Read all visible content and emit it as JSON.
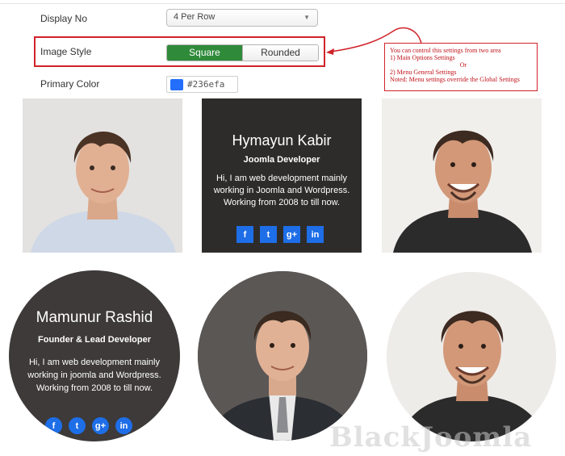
{
  "settings": {
    "display_no": {
      "label": "Display No",
      "value": "4 Per Row"
    },
    "image_style": {
      "label": "Image Style",
      "options": [
        "Square",
        "Rounded"
      ],
      "selected": "Square"
    },
    "primary_color": {
      "label": "Primary Color",
      "value": "#236efa"
    }
  },
  "annotation": {
    "line1": "You can control this settings from two area",
    "line2": "1) Main Options Settings",
    "line3": "Or",
    "line4": "2) Menu General Settings",
    "line5": "Noted: Menu settings override the Global Settings",
    "border_color": "#d0232a"
  },
  "members_square": [
    {
      "photo": "man-young-photo"
    },
    {
      "name": "Hymayun Kabir",
      "role": "Joomla Developer",
      "bio_1": "Hi, I am web development mainly",
      "bio_2": "working in Joomla and Wordpress.",
      "bio_3": "Working from 2008 to till now.",
      "socials": [
        "f",
        "t",
        "g+",
        "in"
      ]
    },
    {
      "photo": "man-smiling-photo"
    }
  ],
  "members_rounded": [
    {
      "name": "Mamunur Rashid",
      "role": "Founder & Lead Developer",
      "bio_1": "Hi, I am web development mainly",
      "bio_2": "working in joomla and Wordpress.",
      "bio_3": "Working from 2008 to till now.",
      "socials": [
        "f",
        "t",
        "g+",
        "in"
      ]
    },
    {
      "photo": "man-suit-photo"
    },
    {
      "photo": "man-smiling-photo"
    }
  ],
  "watermark": "BlackJoomla",
  "colors": {
    "accent_green": "#2f8a3a",
    "social_blue": "#1e6ee8"
  }
}
